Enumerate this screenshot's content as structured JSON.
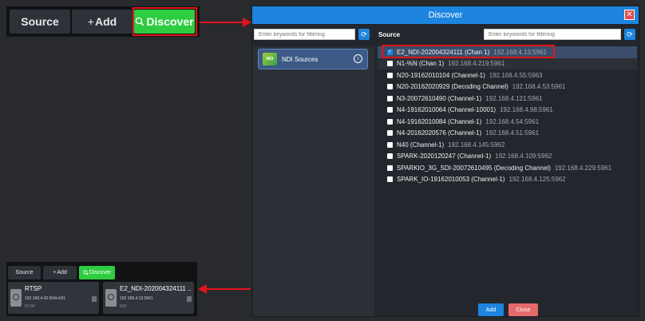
{
  "toolbar": {
    "source_label": "Source",
    "add_label": "Add",
    "discover_label": "Discover"
  },
  "dialog": {
    "title": "Discover",
    "close_glyph": "✕",
    "filter_left_placeholder": "Enter keywords for filtering",
    "filter_right_placeholder": "Enter keywords for filtering",
    "refresh_glyph": "⟳",
    "source_heading": "Source",
    "left_items": [
      {
        "label": "NDI Sources",
        "logo_text": "NDI"
      }
    ],
    "sources": [
      {
        "name": "E2_NDI-202004324111 (Chan 1)",
        "ip": "192.168.4.13:5961",
        "checked": true
      },
      {
        "name": "N1-%N (Chan 1)",
        "ip": "192.168.4.219:5961",
        "checked": false
      },
      {
        "name": "N20-19162010104 (Channel-1)",
        "ip": "192.168.4.55:5963",
        "checked": false
      },
      {
        "name": "N20-20162020929 (Decoding Channel)",
        "ip": "192.168.4.53:5961",
        "checked": false
      },
      {
        "name": "N3-20072610490 (Channel-1)",
        "ip": "192.168.4.121:5961",
        "checked": false
      },
      {
        "name": "N4-19162010064 (Channel-10001)",
        "ip": "192.168.4.98:5961",
        "checked": false
      },
      {
        "name": "N4-19162010084 (Channel-1)",
        "ip": "192.168.4.54:5961",
        "checked": false
      },
      {
        "name": "N4-20162020576 (Channel-1)",
        "ip": "192.168.4.51:5961",
        "checked": false
      },
      {
        "name": "N40 (Channel-1)",
        "ip": "192.168.4.145:5962",
        "checked": false
      },
      {
        "name": "SPARK-2020120247 (Channel-1)",
        "ip": "192.168.4.109:5962",
        "checked": false
      },
      {
        "name": "SPARKIO_3G_SDI-20072610495 (Decoding Channel)",
        "ip": "192.168.4.229:5961",
        "checked": false
      },
      {
        "name": "SPARK_IO-19162010053 (Channel-1)",
        "ip": "192.168.4.125:5962",
        "checked": false
      }
    ],
    "add_label": "Add",
    "close_label": "Close"
  },
  "bottom": {
    "source_label": "Source",
    "add_label": "Add",
    "discover_label": "Discover",
    "cards": [
      {
        "title": "RTSP",
        "address": "192.168.4.42:554/ch01",
        "type": "RTSP"
      },
      {
        "title": "E2_NDI-202004324111 ...",
        "address": "192.168.4.13:5961",
        "type": "NDI"
      }
    ]
  },
  "colors": {
    "accent_blue": "#1d84e0",
    "discover_green": "#2ecc40",
    "highlight_red": "#e3131a",
    "close_red": "#e66a6a"
  },
  "icons": {
    "add": "plus-icon",
    "discover": "search-icon",
    "refresh": "refresh-icon",
    "close": "close-icon",
    "ndi_chevron": "chevron-right-icon",
    "card": "camera-icon"
  }
}
